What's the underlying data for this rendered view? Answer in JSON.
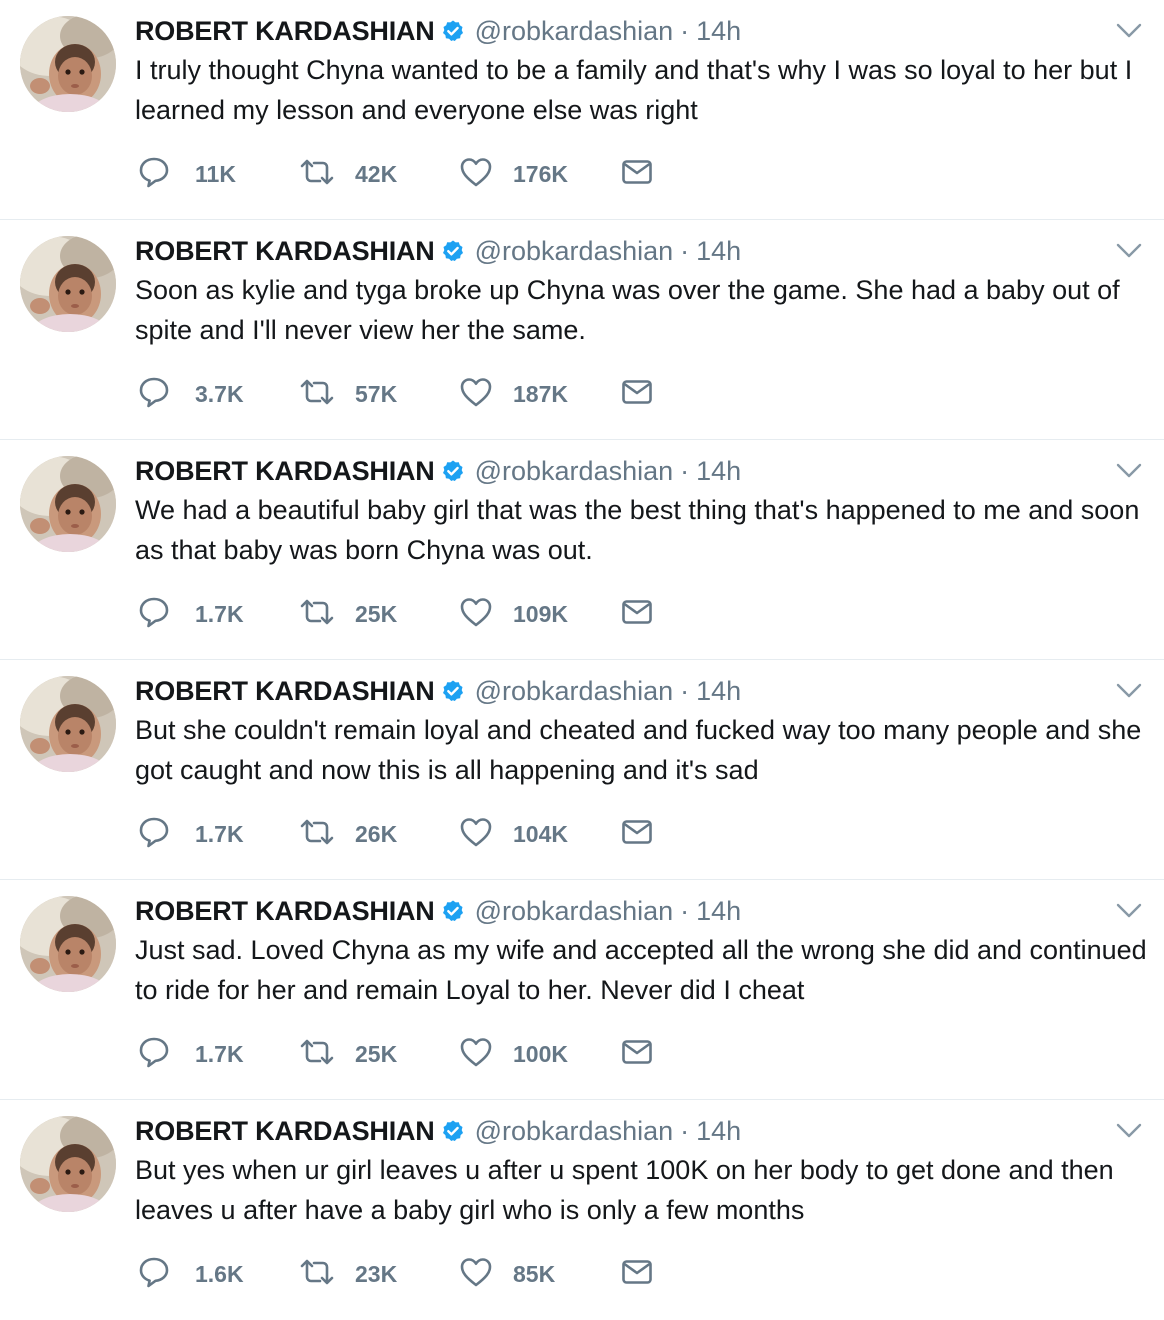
{
  "account": {
    "name": "ROBERT KARDASHIAN",
    "handle": "@robkardashian",
    "separator": "·"
  },
  "colors": {
    "verified_badge": "#1da1f2",
    "secondary_text": "#657786",
    "primary_text": "#14171a",
    "divider": "#e6ecf0"
  },
  "tweets": [
    {
      "time": "14h",
      "text": "I truly thought Chyna wanted to be a family and that's why I was so loyal to her but I learned my lesson and everyone else was right",
      "replies": "11K",
      "retweets": "42K",
      "likes": "176K"
    },
    {
      "time": "14h",
      "text": "Soon as kylie and tyga broke up Chyna was over the game. She had a baby out of spite and I'll never view her the same.",
      "replies": "3.7K",
      "retweets": "57K",
      "likes": "187K"
    },
    {
      "time": "14h",
      "text": "We had a beautiful baby girl that was the best thing that's happened to me and soon as that baby was born Chyna was out.",
      "replies": "1.7K",
      "retweets": "25K",
      "likes": "109K"
    },
    {
      "time": "14h",
      "text": "But she couldn't remain loyal and cheated and fucked way too many people and she got caught and now this is all happening and it's sad",
      "replies": "1.7K",
      "retweets": "26K",
      "likes": "104K"
    },
    {
      "time": "14h",
      "text": "Just sad. Loved Chyna as my wife and accepted all the wrong she did and continued to ride for her and remain Loyal to her. Never did I cheat",
      "replies": "1.7K",
      "retweets": "25K",
      "likes": "100K"
    },
    {
      "time": "14h",
      "text": "But yes when ur girl leaves u after u spent 100K on her body to get done and then leaves u after have a baby girl who is only a few months",
      "replies": "1.6K",
      "retweets": "23K",
      "likes": "85K"
    }
  ],
  "icons": {
    "reply": "reply-icon",
    "retweet": "retweet-icon",
    "like": "heart-icon",
    "dm": "envelope-icon",
    "verified": "verified-badge-icon",
    "more": "chevron-down-icon"
  }
}
